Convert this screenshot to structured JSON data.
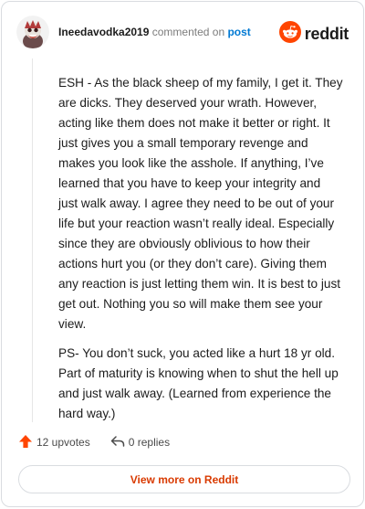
{
  "header": {
    "username": "Ineedavodka2019",
    "action_text": " commented on ",
    "post_link": "post",
    "brand": "reddit"
  },
  "comment": {
    "paragraphs": [
      "ESH - As the black sheep of my family, I get it. They are dicks. They deserved your wrath. However, acting like them does not make it better or right. It just gives you a small temporary revenge and makes you look like the asshole. If anything, I’ve learned that you have to keep your integrity and just walk away. I agree they need to be out of your life but your reaction wasn’t really ideal. Especially since they are obviously oblivious to how their actions hurt you (or they don’t care). Giving them any reaction is just letting them win. It is best to just get out. Nothing you so will make them see your view.",
      "PS- You don’t suck, you acted like a hurt 18 yr old. Part of maturity is knowing when to shut the hell up and just walk away. (Learned from experience the hard way.)"
    ]
  },
  "footer": {
    "upvotes_label": "12 upvotes",
    "replies_label": "0 replies"
  },
  "view_more_label": "View more on Reddit",
  "colors": {
    "brand_orange": "#ff4500",
    "link_blue": "#0079d3",
    "cta_orange": "#d93a00"
  },
  "icons": {
    "avatar": "avatar-icon",
    "logo": "reddit-logo-icon",
    "upvote": "upvote-arrow-icon",
    "reply": "reply-arrow-icon"
  }
}
